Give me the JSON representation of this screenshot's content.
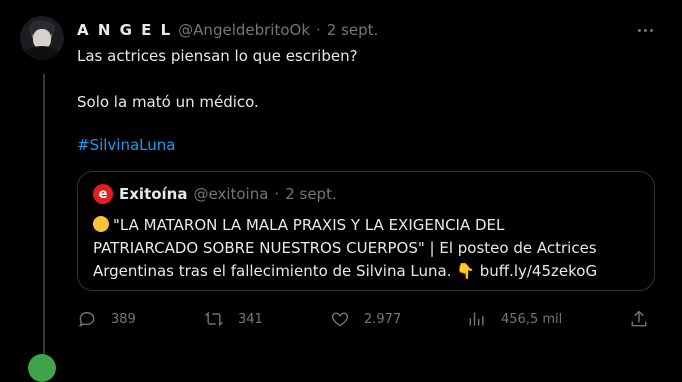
{
  "tweet": {
    "author_name": "A N G E L",
    "author_handle": "@AngeldebritoOk",
    "separator": "·",
    "date": "2 sept.",
    "lines": [
      "Las actrices piensan lo que escriben?",
      "Solo la mató un médico."
    ],
    "hashtag": "#SilvinaLuna"
  },
  "quote": {
    "logo_letter": "e",
    "author_name": "Exitoína",
    "author_handle": "@exitoina",
    "separator": "·",
    "date": "2 sept.",
    "line1": "\"LA MATARON LA MALA PRAXIS Y LA EXIGENCIA DEL",
    "line2": "PATRIARCADO SOBRE NUESTROS CUERPOS\" | El posteo de Actrices",
    "line3": "Argentinas tras el fallecimiento de Silvina Luna. 👇 buff.ly/45zekoG"
  },
  "actions": {
    "replies": "389",
    "retweets": "341",
    "likes": "2.977",
    "views": "456,5 mil"
  },
  "icons": [
    "more-icon",
    "reply-icon",
    "retweet-icon",
    "like-icon",
    "views-icon",
    "share-icon"
  ]
}
